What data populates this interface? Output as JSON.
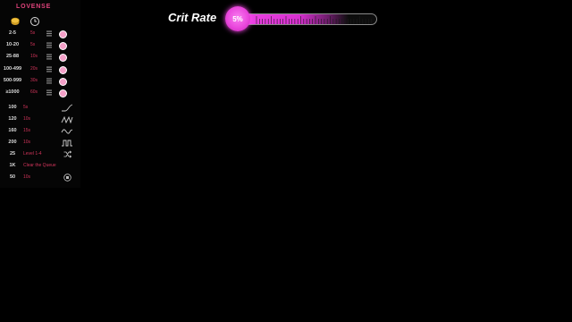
{
  "app": {
    "brand": "LOVENSE"
  },
  "colors": {
    "accent": "#ea48dd",
    "label": "#d0345a",
    "dot": "#f4a0c8"
  },
  "tip_levels": [
    {
      "range": "2-5",
      "duration": "5s",
      "icon": "level-bars-icon"
    },
    {
      "range": "10-20",
      "duration": "5s",
      "icon": "level-bars-icon"
    },
    {
      "range": "25-88",
      "duration": "10s",
      "icon": "level-bars-icon"
    },
    {
      "range": "100-499",
      "duration": "20s",
      "icon": "level-bars-icon"
    },
    {
      "range": "500-999",
      "duration": "30s",
      "icon": "level-bars-icon"
    },
    {
      "range": "≥1000",
      "duration": "60s",
      "icon": "level-bars-icon"
    }
  ],
  "special_commands": [
    {
      "amount": "100",
      "text": "5s",
      "icon": "wave-pattern-icon"
    },
    {
      "amount": "120",
      "text": "10s",
      "icon": "pulse-pattern-icon"
    },
    {
      "amount": "160",
      "text": "15s",
      "icon": "earthquake-pattern-icon"
    },
    {
      "amount": "200",
      "text": "10s",
      "icon": "fireworks-pattern-icon"
    },
    {
      "amount": "25",
      "text": "Level 1-4",
      "icon": "random-icon"
    },
    {
      "amount": "1K",
      "text": "Clear the Queue",
      "icon": ""
    },
    {
      "amount": "50",
      "text": "10s",
      "icon": "stop-icon"
    }
  ],
  "main": {
    "title": "Crit Rate",
    "progress_label": "5%",
    "progress_value": 0.8
  }
}
